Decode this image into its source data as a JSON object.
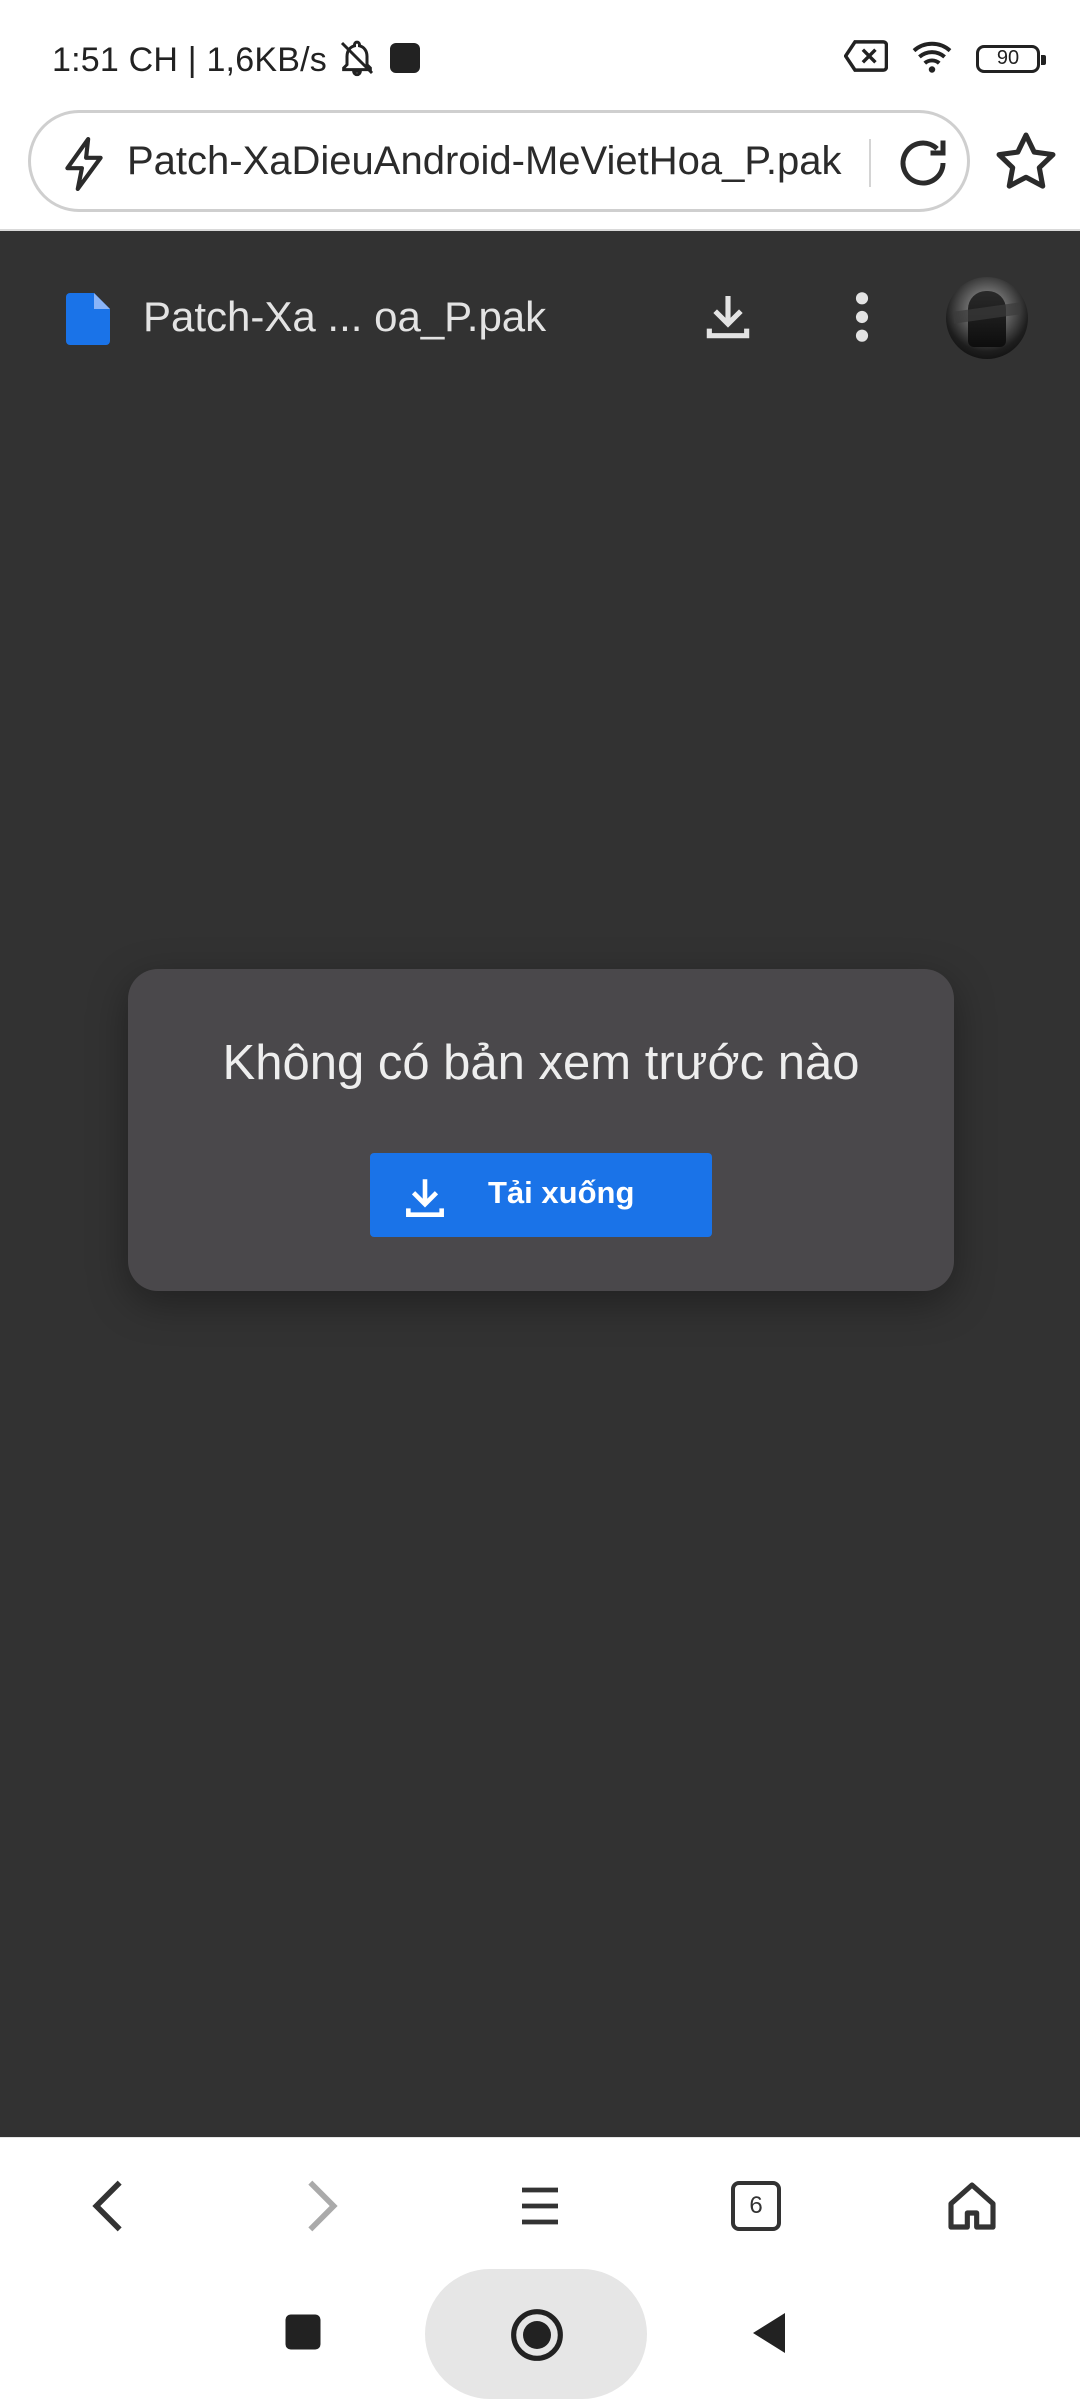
{
  "status_bar": {
    "time_speed": "1:51 CH | 1,6KB/s",
    "battery": "90",
    "icons": [
      "bell-off-icon",
      "notification-square-icon",
      "sim-blocked-icon",
      "wifi-icon",
      "battery-icon"
    ]
  },
  "omnibox": {
    "url": "Patch-XaDieuAndroid-MeVietHoa_P.pak",
    "icons": [
      "lightning-icon",
      "reload-icon",
      "star-icon"
    ]
  },
  "viewer": {
    "file_name": "Patch-Xa ... oa_P.pak",
    "icons": [
      "file-icon",
      "download-icon",
      "more-vert-icon"
    ],
    "background": "#323232"
  },
  "preview": {
    "message": "Không có bản xem trước nào",
    "download_label": "Tải xuống",
    "accent": "#1a73e8"
  },
  "toolbar": {
    "tab_count": "6",
    "icons": [
      "back-icon",
      "forward-icon",
      "menu-icon",
      "tabs-icon",
      "home-icon"
    ]
  },
  "system_nav": {
    "icons": [
      "recents-square-icon",
      "home-circle-icon",
      "back-triangle-icon"
    ]
  }
}
